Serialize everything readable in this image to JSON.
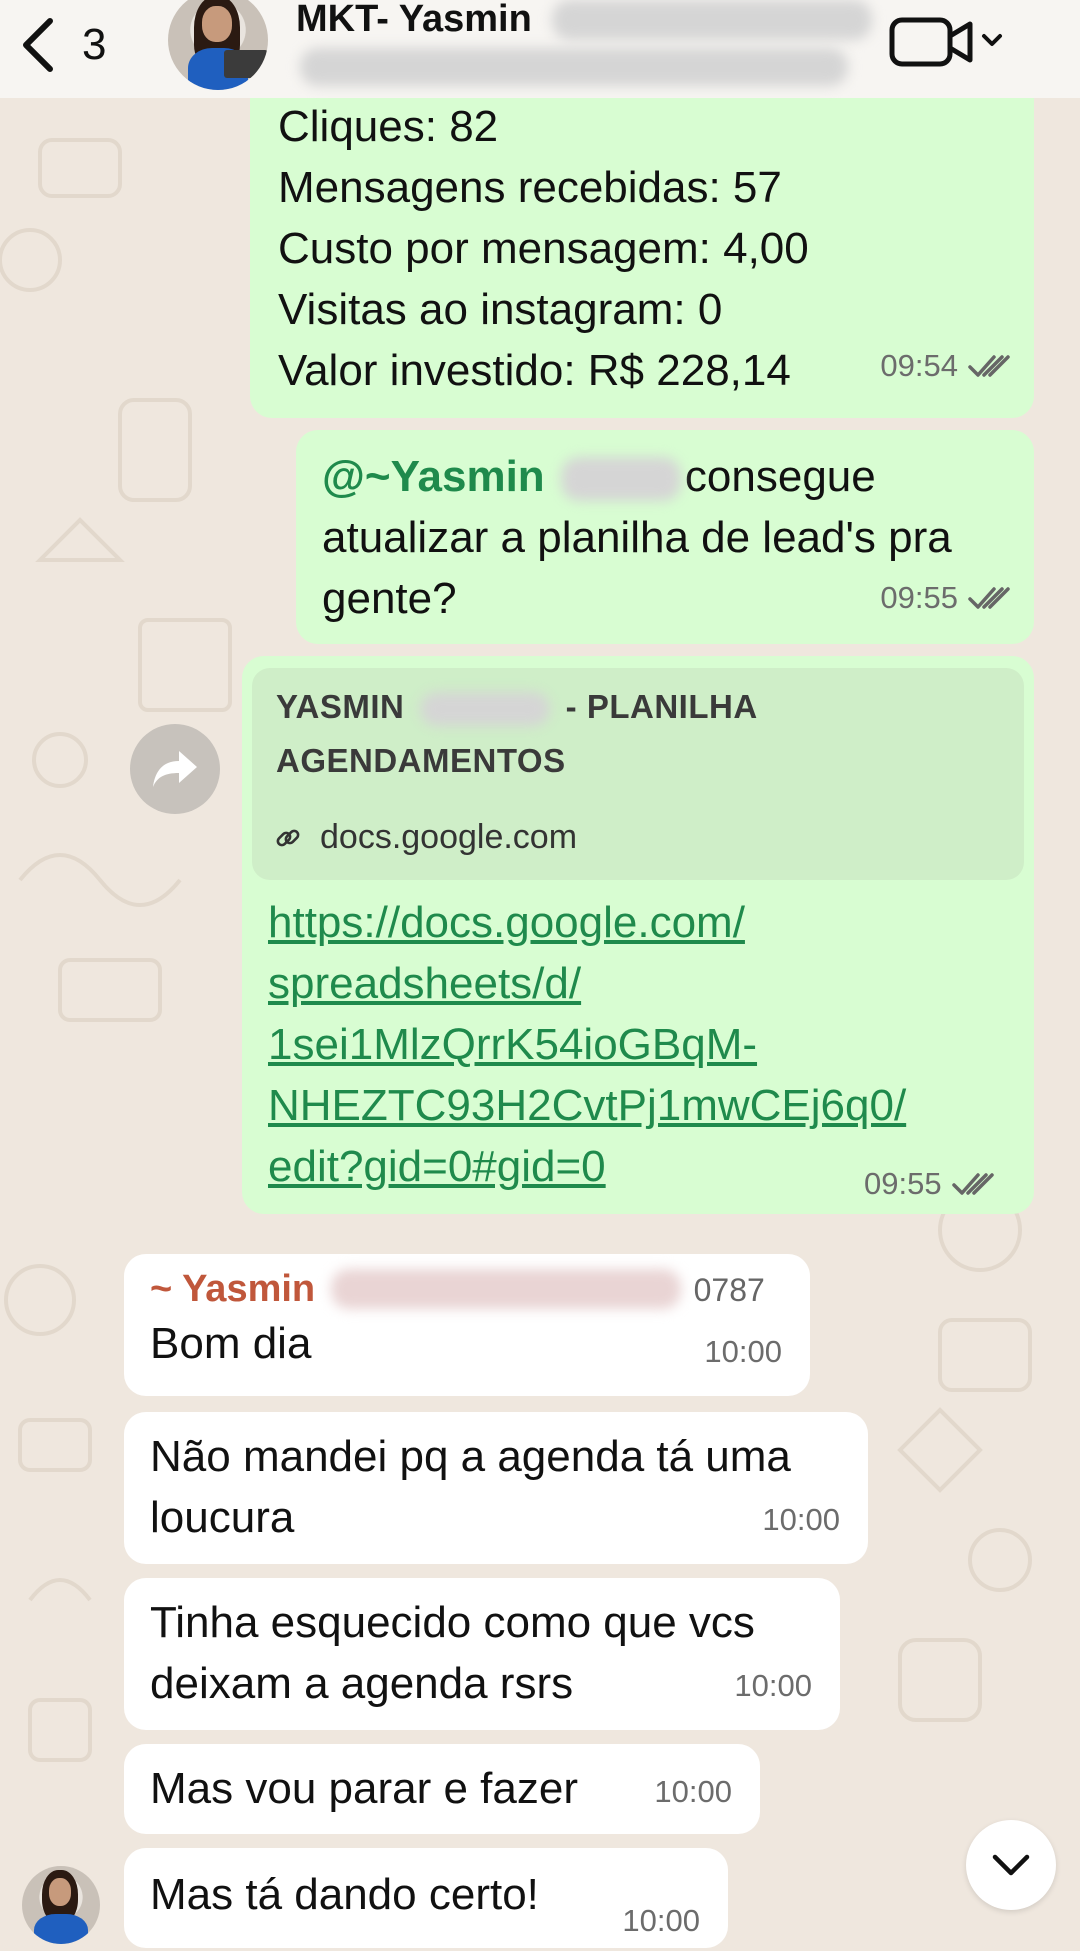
{
  "header": {
    "back_count": "3",
    "title": "MKT- Yasmin"
  },
  "messages": {
    "m1": {
      "lines": [
        "Cliques: 82",
        "Mensagens recebidas: 57",
        "Custo por mensagem: 4,00",
        "Visitas ao instagram: 0",
        "Valor investido: R$ 228,14"
      ],
      "time": "09:54"
    },
    "m2": {
      "mention": "@~Yasmin",
      "line1_rest": "consegue",
      "line2": "atualizar a planilha de lead's pra",
      "line3": "gente?",
      "time": "09:55"
    },
    "m3": {
      "preview_title_part1": "YASMIN",
      "preview_title_part2": "- PLANILHA",
      "preview_title_line2": "AGENDAMENTOS",
      "preview_domain": "docs.google.com",
      "link_lines": [
        "https://docs.google.com/",
        "spreadsheets/d/",
        "1sei1MlzQrrK54ioGBqM-",
        "NHEZTC93H2CvtPj1mwCEj6q0/",
        "edit?gid=0#gid=0"
      ],
      "time": "09:55"
    },
    "m4": {
      "sender": "~ Yasmin",
      "phone_tail": "0787",
      "text": "Bom dia",
      "time": "10:00"
    },
    "m5": {
      "lines": [
        "Não mandei pq a agenda tá uma",
        "loucura"
      ],
      "time": "10:00"
    },
    "m6": {
      "lines": [
        "Tinha esquecido como que vcs",
        "deixam a agenda rsrs"
      ],
      "time": "10:00"
    },
    "m7": {
      "text": "Mas vou parar e fazer",
      "time": "10:00"
    },
    "m8": {
      "text": "Mas tá dando certo!",
      "time": "10:00"
    }
  },
  "icons": {
    "back": "chevron-left-icon",
    "video": "video-camera-icon",
    "forward": "forward-arrow-icon",
    "scroll": "chevron-down-icon",
    "read": "double-check-icon",
    "link": "link-icon"
  },
  "colors": {
    "outgoing_bubble": "#d8fdd2",
    "incoming_bubble": "#ffffff",
    "link_green": "#1f8a4c",
    "sender_name": "#c0573b",
    "wallpaper": "#efe7de"
  }
}
